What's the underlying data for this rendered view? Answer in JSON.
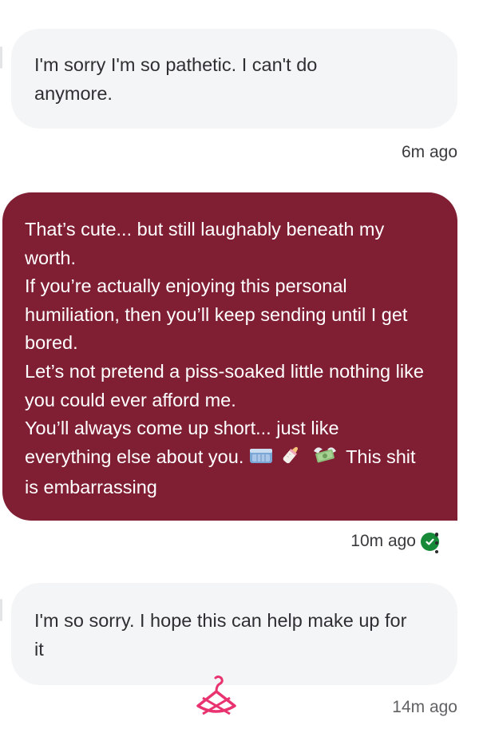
{
  "messages": [
    {
      "direction": "incoming",
      "text": "I'm sorry I'm so pathetic. I can't do anymore.",
      "time": "6m ago"
    },
    {
      "direction": "outgoing",
      "lines": [
        "That’s cute... but still laughably beneath my worth.",
        "If you’re actually enjoying this personal humiliation, then you’ll keep sending until I get bored.",
        "Let’s not pretend a piss-soaked little nothing like you could ever afford me.",
        "You’ll always come up short... just like everything else about you."
      ],
      "emojis": [
        "diaper",
        "baby-bottle",
        "money-with-wings"
      ],
      "tail": "This shit is embarrassing",
      "time": "10m ago",
      "status": "read"
    },
    {
      "direction": "incoming",
      "text": "I'm so sorry. I hope this can help make up for it",
      "time": "14m ago"
    }
  ],
  "colors": {
    "incoming_bubble": "#f4f5f6",
    "outgoing_bubble": "#801f33",
    "check": "#178a3a",
    "watermark": "#e8336f"
  }
}
